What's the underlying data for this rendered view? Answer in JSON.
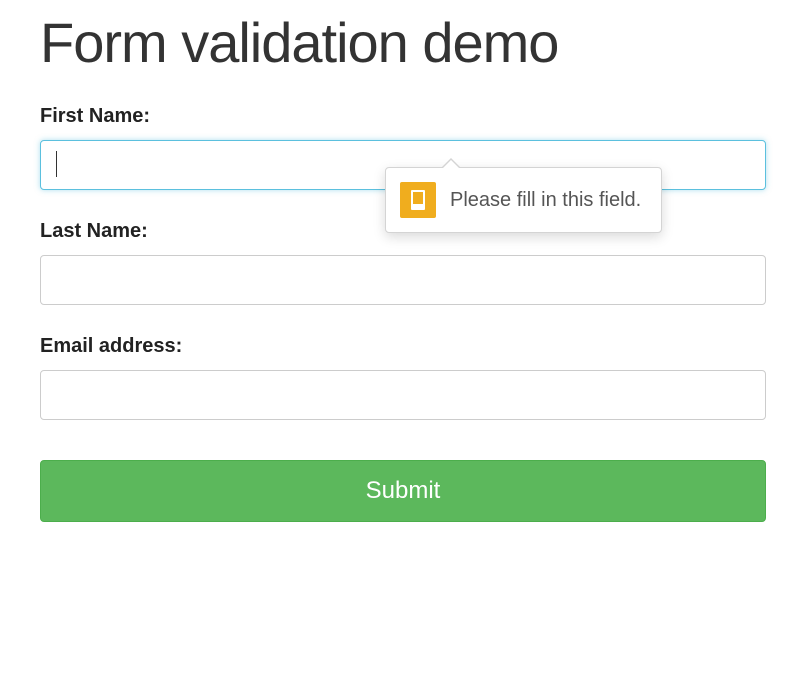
{
  "title": "Form validation demo",
  "fields": {
    "first_name": {
      "label": "First Name:",
      "value": "",
      "placeholder": ""
    },
    "last_name": {
      "label": "Last Name:",
      "value": "",
      "placeholder": ""
    },
    "email": {
      "label": "Email address:",
      "value": "",
      "placeholder": ""
    }
  },
  "validation": {
    "message": "Please fill in this field."
  },
  "buttons": {
    "submit": "Submit"
  }
}
